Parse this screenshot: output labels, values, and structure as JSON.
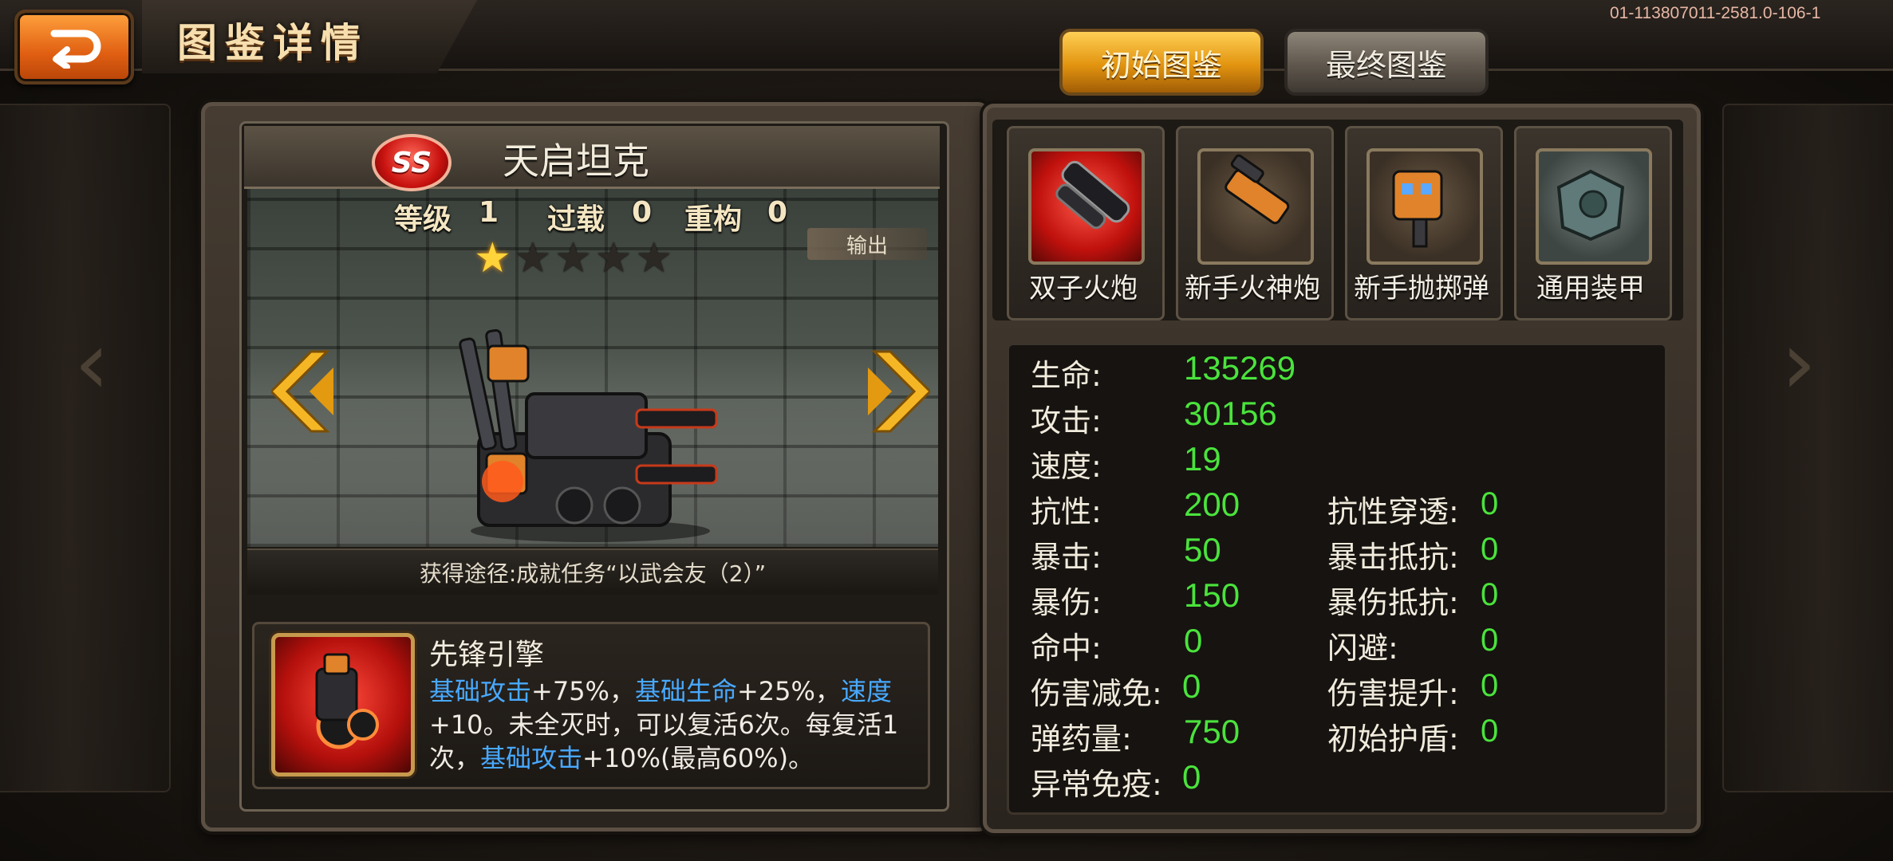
{
  "header": {
    "title": "图鉴详情",
    "build_id": "01-113807011-2581.0-106-1",
    "tabs": {
      "initial": "初始图鉴",
      "final": "最终图鉴"
    }
  },
  "unit": {
    "rank": "SS",
    "name": "天启坦克",
    "level_label": "等级",
    "level_value": "1",
    "overload_label": "过载",
    "overload_value": "0",
    "rebuild_label": "重构",
    "rebuild_value": "0",
    "stars_filled": 1,
    "stars_total": 5,
    "role_tag": "输出",
    "source_text": "获得途径:成就任务“以武会友（2）”"
  },
  "skill": {
    "name": "先锋引擎",
    "desc": [
      {
        "text": "基础攻击",
        "hl": true
      },
      {
        "text": "+75%，",
        "hl": false
      },
      {
        "text": "基础生命",
        "hl": true
      },
      {
        "text": "+25%，",
        "hl": false
      },
      {
        "text": "速度",
        "hl": true
      },
      {
        "text": "+10。未全灭时，可以复活6次。每复活1次，",
        "hl": false
      },
      {
        "text": "基础攻击",
        "hl": true
      },
      {
        "text": "+10%(最高60%)。",
        "hl": false
      }
    ]
  },
  "equipment": [
    {
      "label": "双子火炮",
      "icon": "twin-cannon-icon",
      "style": "eq-red"
    },
    {
      "label": "新手火神炮",
      "icon": "vulcan-cannon-icon",
      "style": "eq-brown"
    },
    {
      "label": "新手抛掷弹",
      "icon": "throwing-bomb-icon",
      "style": "eq-brown"
    },
    {
      "label": "通用装甲",
      "icon": "armor-icon",
      "style": "eq-gray"
    }
  ],
  "stats": {
    "left": [
      {
        "label": "生命:",
        "value": "135269"
      },
      {
        "label": "攻击:",
        "value": "30156"
      },
      {
        "label": "速度:",
        "value": "19"
      },
      {
        "label": "抗性:",
        "value": "200"
      },
      {
        "label": "暴击:",
        "value": "50"
      },
      {
        "label": "暴伤:",
        "value": "150"
      },
      {
        "label": "命中:",
        "value": "0"
      },
      {
        "label": "伤害减免:",
        "value": "0"
      },
      {
        "label": "弹药量:",
        "value": "750"
      },
      {
        "label": "异常免疫:",
        "value": "0"
      }
    ],
    "right": [
      {
        "label": "抗性穿透:",
        "value": "0"
      },
      {
        "label": "暴击抵抗:",
        "value": "0"
      },
      {
        "label": "暴伤抵抗:",
        "value": "0"
      },
      {
        "label": "闪避:",
        "value": "0"
      },
      {
        "label": "伤害提升:",
        "value": "0"
      },
      {
        "label": "初始护盾:",
        "value": "0"
      }
    ]
  },
  "colors": {
    "stat_value": "#4ae33c",
    "highlight": "#48a9ff",
    "accent_gold": "#e2940f"
  }
}
